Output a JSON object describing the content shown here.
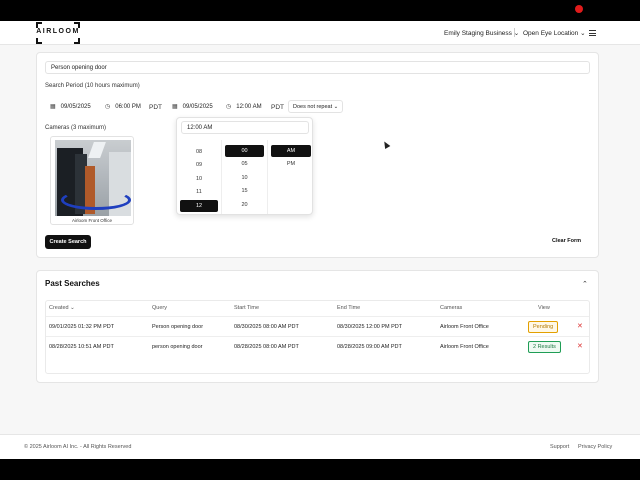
{
  "brand": {
    "logo_text": "AIRLOOM"
  },
  "header": {
    "org": "Emily Staging Business",
    "location": "Open Eye Location"
  },
  "search_form": {
    "query_value": "Person opening door",
    "period_label": "Search Period (10 hours maximum)",
    "start_date": "09/05/2025",
    "start_time": "06:00 PM",
    "start_tz": "PDT",
    "end_date": "09/05/2025",
    "end_time": "12:00 AM",
    "end_tz": "PDT",
    "repeat": "Does not repeat",
    "cameras_label": "Cameras (3 maximum)",
    "camera_name": "Airloom Front Office",
    "create_button": "Create Search",
    "clear_button": "Clear Form"
  },
  "time_picker": {
    "value": "12:00 AM",
    "hours": [
      "08",
      "09",
      "10",
      "11",
      "12"
    ],
    "selected_hour": "12",
    "minutes": [
      "00",
      "05",
      "10",
      "15",
      "20"
    ],
    "selected_minute": "00",
    "periods": [
      "AM",
      "PM"
    ],
    "selected_period": "AM"
  },
  "past_searches": {
    "title": "Past Searches",
    "columns": [
      "Created",
      "Query",
      "Start Time",
      "End Time",
      "Cameras",
      "View"
    ],
    "rows": [
      {
        "created": "09/01/2025 01:32 PM PDT",
        "query": "Person opening door",
        "start": "08/30/2025 08:00 AM PDT",
        "end": "08/30/2025 12:00 PM PDT",
        "camera": "Airloom Front Office",
        "status": "Pending"
      },
      {
        "created": "08/28/2025 10:51 AM PDT",
        "query": "person opening door",
        "start": "08/28/2025 08:00 AM PDT",
        "end": "08/28/2025 09:00 AM PDT",
        "camera": "Airloom Front Office",
        "status": "2 Results"
      }
    ]
  },
  "footer": {
    "copyright": "© 2025 Airloom AI Inc. - All Rights Reserved",
    "support": "Support",
    "privacy": "Privacy Policy"
  }
}
